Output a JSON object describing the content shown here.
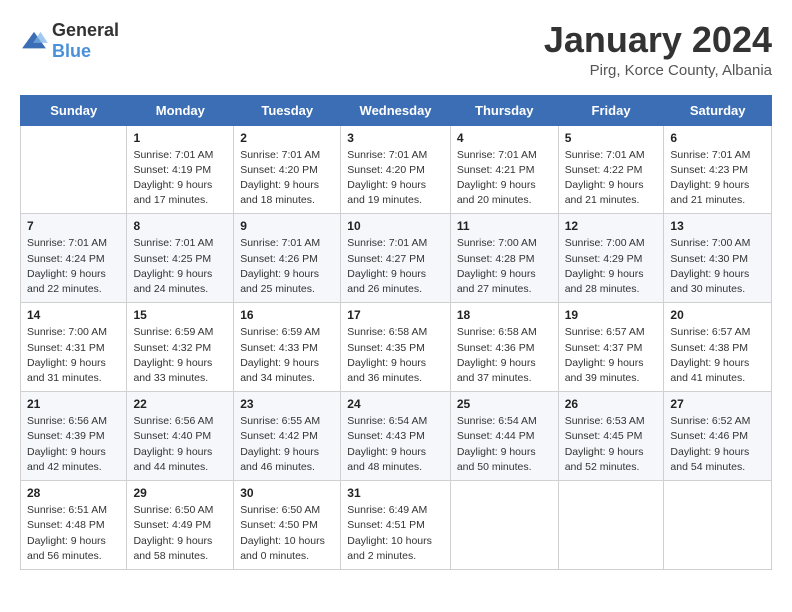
{
  "header": {
    "logo_general": "General",
    "logo_blue": "Blue",
    "month": "January 2024",
    "location": "Pirg, Korce County, Albania"
  },
  "weekdays": [
    "Sunday",
    "Monday",
    "Tuesday",
    "Wednesday",
    "Thursday",
    "Friday",
    "Saturday"
  ],
  "weeks": [
    [
      {
        "day": "",
        "sunrise": "",
        "sunset": "",
        "daylight": ""
      },
      {
        "day": "1",
        "sunrise": "Sunrise: 7:01 AM",
        "sunset": "Sunset: 4:19 PM",
        "daylight": "Daylight: 9 hours and 17 minutes."
      },
      {
        "day": "2",
        "sunrise": "Sunrise: 7:01 AM",
        "sunset": "Sunset: 4:20 PM",
        "daylight": "Daylight: 9 hours and 18 minutes."
      },
      {
        "day": "3",
        "sunrise": "Sunrise: 7:01 AM",
        "sunset": "Sunset: 4:20 PM",
        "daylight": "Daylight: 9 hours and 19 minutes."
      },
      {
        "day": "4",
        "sunrise": "Sunrise: 7:01 AM",
        "sunset": "Sunset: 4:21 PM",
        "daylight": "Daylight: 9 hours and 20 minutes."
      },
      {
        "day": "5",
        "sunrise": "Sunrise: 7:01 AM",
        "sunset": "Sunset: 4:22 PM",
        "daylight": "Daylight: 9 hours and 21 minutes."
      },
      {
        "day": "6",
        "sunrise": "Sunrise: 7:01 AM",
        "sunset": "Sunset: 4:23 PM",
        "daylight": "Daylight: 9 hours and 21 minutes."
      }
    ],
    [
      {
        "day": "7",
        "sunrise": "Sunrise: 7:01 AM",
        "sunset": "Sunset: 4:24 PM",
        "daylight": "Daylight: 9 hours and 22 minutes."
      },
      {
        "day": "8",
        "sunrise": "Sunrise: 7:01 AM",
        "sunset": "Sunset: 4:25 PM",
        "daylight": "Daylight: 9 hours and 24 minutes."
      },
      {
        "day": "9",
        "sunrise": "Sunrise: 7:01 AM",
        "sunset": "Sunset: 4:26 PM",
        "daylight": "Daylight: 9 hours and 25 minutes."
      },
      {
        "day": "10",
        "sunrise": "Sunrise: 7:01 AM",
        "sunset": "Sunset: 4:27 PM",
        "daylight": "Daylight: 9 hours and 26 minutes."
      },
      {
        "day": "11",
        "sunrise": "Sunrise: 7:00 AM",
        "sunset": "Sunset: 4:28 PM",
        "daylight": "Daylight: 9 hours and 27 minutes."
      },
      {
        "day": "12",
        "sunrise": "Sunrise: 7:00 AM",
        "sunset": "Sunset: 4:29 PM",
        "daylight": "Daylight: 9 hours and 28 minutes."
      },
      {
        "day": "13",
        "sunrise": "Sunrise: 7:00 AM",
        "sunset": "Sunset: 4:30 PM",
        "daylight": "Daylight: 9 hours and 30 minutes."
      }
    ],
    [
      {
        "day": "14",
        "sunrise": "Sunrise: 7:00 AM",
        "sunset": "Sunset: 4:31 PM",
        "daylight": "Daylight: 9 hours and 31 minutes."
      },
      {
        "day": "15",
        "sunrise": "Sunrise: 6:59 AM",
        "sunset": "Sunset: 4:32 PM",
        "daylight": "Daylight: 9 hours and 33 minutes."
      },
      {
        "day": "16",
        "sunrise": "Sunrise: 6:59 AM",
        "sunset": "Sunset: 4:33 PM",
        "daylight": "Daylight: 9 hours and 34 minutes."
      },
      {
        "day": "17",
        "sunrise": "Sunrise: 6:58 AM",
        "sunset": "Sunset: 4:35 PM",
        "daylight": "Daylight: 9 hours and 36 minutes."
      },
      {
        "day": "18",
        "sunrise": "Sunrise: 6:58 AM",
        "sunset": "Sunset: 4:36 PM",
        "daylight": "Daylight: 9 hours and 37 minutes."
      },
      {
        "day": "19",
        "sunrise": "Sunrise: 6:57 AM",
        "sunset": "Sunset: 4:37 PM",
        "daylight": "Daylight: 9 hours and 39 minutes."
      },
      {
        "day": "20",
        "sunrise": "Sunrise: 6:57 AM",
        "sunset": "Sunset: 4:38 PM",
        "daylight": "Daylight: 9 hours and 41 minutes."
      }
    ],
    [
      {
        "day": "21",
        "sunrise": "Sunrise: 6:56 AM",
        "sunset": "Sunset: 4:39 PM",
        "daylight": "Daylight: 9 hours and 42 minutes."
      },
      {
        "day": "22",
        "sunrise": "Sunrise: 6:56 AM",
        "sunset": "Sunset: 4:40 PM",
        "daylight": "Daylight: 9 hours and 44 minutes."
      },
      {
        "day": "23",
        "sunrise": "Sunrise: 6:55 AM",
        "sunset": "Sunset: 4:42 PM",
        "daylight": "Daylight: 9 hours and 46 minutes."
      },
      {
        "day": "24",
        "sunrise": "Sunrise: 6:54 AM",
        "sunset": "Sunset: 4:43 PM",
        "daylight": "Daylight: 9 hours and 48 minutes."
      },
      {
        "day": "25",
        "sunrise": "Sunrise: 6:54 AM",
        "sunset": "Sunset: 4:44 PM",
        "daylight": "Daylight: 9 hours and 50 minutes."
      },
      {
        "day": "26",
        "sunrise": "Sunrise: 6:53 AM",
        "sunset": "Sunset: 4:45 PM",
        "daylight": "Daylight: 9 hours and 52 minutes."
      },
      {
        "day": "27",
        "sunrise": "Sunrise: 6:52 AM",
        "sunset": "Sunset: 4:46 PM",
        "daylight": "Daylight: 9 hours and 54 minutes."
      }
    ],
    [
      {
        "day": "28",
        "sunrise": "Sunrise: 6:51 AM",
        "sunset": "Sunset: 4:48 PM",
        "daylight": "Daylight: 9 hours and 56 minutes."
      },
      {
        "day": "29",
        "sunrise": "Sunrise: 6:50 AM",
        "sunset": "Sunset: 4:49 PM",
        "daylight": "Daylight: 9 hours and 58 minutes."
      },
      {
        "day": "30",
        "sunrise": "Sunrise: 6:50 AM",
        "sunset": "Sunset: 4:50 PM",
        "daylight": "Daylight: 10 hours and 0 minutes."
      },
      {
        "day": "31",
        "sunrise": "Sunrise: 6:49 AM",
        "sunset": "Sunset: 4:51 PM",
        "daylight": "Daylight: 10 hours and 2 minutes."
      },
      {
        "day": "",
        "sunrise": "",
        "sunset": "",
        "daylight": ""
      },
      {
        "day": "",
        "sunrise": "",
        "sunset": "",
        "daylight": ""
      },
      {
        "day": "",
        "sunrise": "",
        "sunset": "",
        "daylight": ""
      }
    ]
  ]
}
